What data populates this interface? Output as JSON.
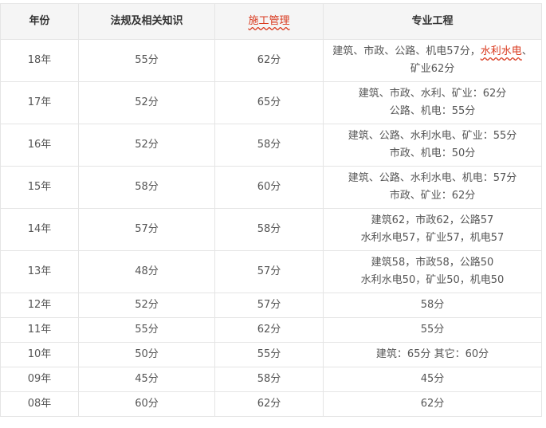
{
  "table": {
    "headers": [
      "年份",
      "法规及相关知识",
      "施工管理",
      "专业工程"
    ],
    "rows": [
      {
        "year": "18年",
        "law": "55分",
        "mgmt": "62分",
        "prof_a": "建筑、市政、公路、机电57分，",
        "prof_a_mark": "水利水电",
        "prof_a_tail": "、",
        "prof_b": "矿业62分"
      },
      {
        "year": "17年",
        "law": "52分",
        "mgmt": "65分",
        "prof_a": "建筑、市政、水利、矿业：62分",
        "prof_b": "公路、机电：55分"
      },
      {
        "year": "16年",
        "law": "52分",
        "mgmt": "58分",
        "prof_a": "建筑、公路、水利水电、矿业：55分",
        "prof_b": "市政、机电：50分"
      },
      {
        "year": "15年",
        "law": "58分",
        "mgmt": "60分",
        "prof_a": "建筑、公路、水利水电、机电：57分",
        "prof_b": "市政、矿业：62分"
      },
      {
        "year": "14年",
        "law": "57分",
        "mgmt": "58分",
        "prof_a": "建筑62，市政62，公路57",
        "prof_b": "水利水电57，矿业57，机电57"
      },
      {
        "year": "13年",
        "law": "48分",
        "mgmt": "57分",
        "prof_a": "建筑58，市政58，公路50",
        "prof_b": "水利水电50，矿业50，机电50"
      },
      {
        "year": "12年",
        "law": "52分",
        "mgmt": "57分",
        "prof": "58分"
      },
      {
        "year": "11年",
        "law": "55分",
        "mgmt": "62分",
        "prof": "55分"
      },
      {
        "year": "10年",
        "law": "50分",
        "mgmt": "55分",
        "prof": "建筑：65分 其它：60分"
      },
      {
        "year": "09年",
        "law": "45分",
        "mgmt": "58分",
        "prof": "45分"
      },
      {
        "year": "08年",
        "law": "60分",
        "mgmt": "62分",
        "prof": "62分"
      }
    ]
  }
}
